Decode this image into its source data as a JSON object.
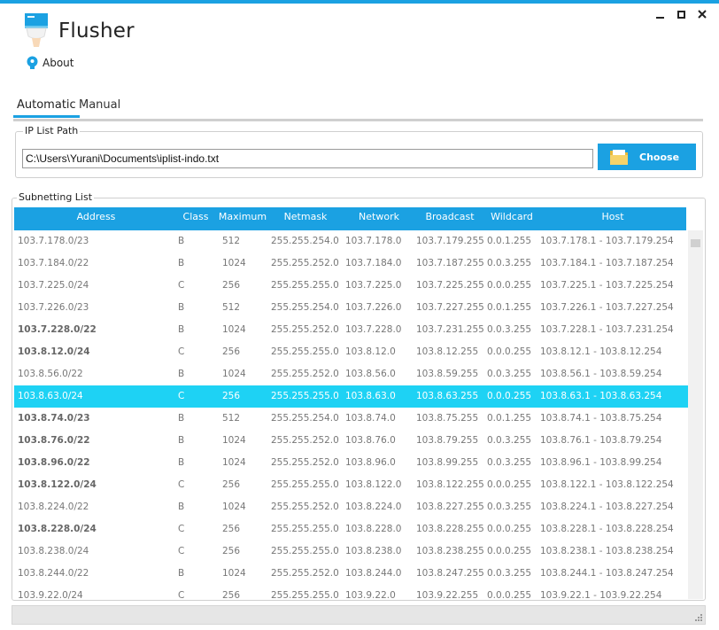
{
  "app": {
    "title": "Flusher"
  },
  "window": {
    "minimize": "minimize",
    "maximize": "maximize",
    "close": "×"
  },
  "menu": {
    "about_label": "About"
  },
  "tabs": [
    {
      "label": "Automatic",
      "active": true
    },
    {
      "label": "Manual",
      "active": false
    }
  ],
  "ip_list": {
    "group_label": "IP List Path",
    "path_value": "C:\\Users\\Yurani\\Documents\\iplist-indo.txt",
    "choose_label": "Choose"
  },
  "subnetting": {
    "group_label": "Subnetting List",
    "columns": [
      "Address",
      "Class",
      "Maximum",
      "Netmask",
      "Network",
      "Broadcast",
      "Wildcard",
      "Host"
    ],
    "rows": [
      [
        "103.7.178.0/23",
        "B",
        "512",
        "255.255.254.0",
        "103.7.178.0",
        "103.7.179.255",
        "0.0.1.255",
        "103.7.178.1 - 103.7.179.254"
      ],
      [
        "103.7.184.0/22",
        "B",
        "1024",
        "255.255.252.0",
        "103.7.184.0",
        "103.7.187.255",
        "0.0.3.255",
        "103.7.184.1 - 103.7.187.254"
      ],
      [
        "103.7.225.0/24",
        "C",
        "256",
        "255.255.255.0",
        "103.7.225.0",
        "103.7.225.255",
        "0.0.0.255",
        "103.7.225.1 - 103.7.225.254"
      ],
      [
        "103.7.226.0/23",
        "B",
        "512",
        "255.255.254.0",
        "103.7.226.0",
        "103.7.227.255",
        "0.0.1.255",
        "103.7.226.1 - 103.7.227.254"
      ],
      [
        "103.7.228.0/22",
        "B",
        "1024",
        "255.255.252.0",
        "103.7.228.0",
        "103.7.231.255",
        "0.0.3.255",
        "103.7.228.1 - 103.7.231.254"
      ],
      [
        "103.8.12.0/24",
        "C",
        "256",
        "255.255.255.0",
        "103.8.12.0",
        "103.8.12.255",
        "0.0.0.255",
        "103.8.12.1 - 103.8.12.254"
      ],
      [
        "103.8.56.0/22",
        "B",
        "1024",
        "255.255.252.0",
        "103.8.56.0",
        "103.8.59.255",
        "0.0.3.255",
        "103.8.56.1 - 103.8.59.254"
      ],
      [
        "103.8.63.0/24",
        "C",
        "256",
        "255.255.255.0",
        "103.8.63.0",
        "103.8.63.255",
        "0.0.0.255",
        "103.8.63.1 - 103.8.63.254"
      ],
      [
        "103.8.74.0/23",
        "B",
        "512",
        "255.255.254.0",
        "103.8.74.0",
        "103.8.75.255",
        "0.0.1.255",
        "103.8.74.1 - 103.8.75.254"
      ],
      [
        "103.8.76.0/22",
        "B",
        "1024",
        "255.255.252.0",
        "103.8.76.0",
        "103.8.79.255",
        "0.0.3.255",
        "103.8.76.1 - 103.8.79.254"
      ],
      [
        "103.8.96.0/22",
        "B",
        "1024",
        "255.255.252.0",
        "103.8.96.0",
        "103.8.99.255",
        "0.0.3.255",
        "103.8.96.1 - 103.8.99.254"
      ],
      [
        "103.8.122.0/24",
        "C",
        "256",
        "255.255.255.0",
        "103.8.122.0",
        "103.8.122.255",
        "0.0.0.255",
        "103.8.122.1 - 103.8.122.254"
      ],
      [
        "103.8.224.0/22",
        "B",
        "1024",
        "255.255.252.0",
        "103.8.224.0",
        "103.8.227.255",
        "0.0.3.255",
        "103.8.224.1 - 103.8.227.254"
      ],
      [
        "103.8.228.0/24",
        "C",
        "256",
        "255.255.255.0",
        "103.8.228.0",
        "103.8.228.255",
        "0.0.0.255",
        "103.8.228.1 - 103.8.228.254"
      ],
      [
        "103.8.238.0/24",
        "C",
        "256",
        "255.255.255.0",
        "103.8.238.0",
        "103.8.238.255",
        "0.0.0.255",
        "103.8.238.1 - 103.8.238.254"
      ],
      [
        "103.8.244.0/22",
        "B",
        "1024",
        "255.255.252.0",
        "103.8.244.0",
        "103.8.247.255",
        "0.0.3.255",
        "103.8.244.1 - 103.8.247.254"
      ],
      [
        "103.9.22.0/24",
        "C",
        "256",
        "255.255.255.0",
        "103.9.22.0",
        "103.9.22.255",
        "0.0.0.255",
        "103.9.22.1 - 103.9.22.254"
      ]
    ],
    "bold_rows": [
      4,
      5,
      8,
      9,
      10,
      11,
      13
    ],
    "selected_row": 7
  },
  "colors": {
    "accent": "#1ba1e2",
    "selected_row": "#1ed2f4"
  }
}
